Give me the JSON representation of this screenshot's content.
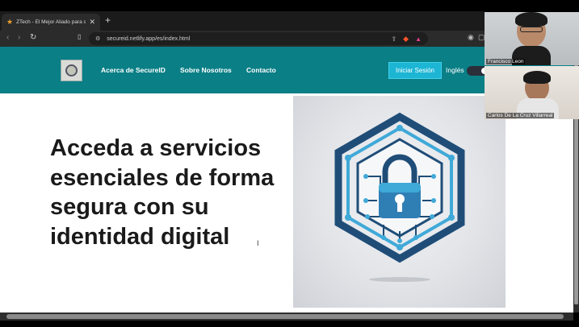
{
  "browser": {
    "tab_title": "ZTech - El Mejor Aliado para su",
    "tab_close": "✕",
    "new_tab": "+",
    "url": "secureid.netlify.app/es/index.html"
  },
  "site": {
    "nav": {
      "links": [
        "Acerca de SecureID",
        "Sobre Nosotros",
        "Contacto"
      ],
      "login_label": "Iniciar Sesión",
      "language_label": "Inglés"
    },
    "hero": {
      "title": "Acceda a servicios esenciales de forma segura con su identidad digital"
    }
  },
  "call": {
    "participants": [
      {
        "name": "Francisco Leon"
      },
      {
        "name": "Carlos De La Cruz Villarreal"
      }
    ]
  },
  "colors": {
    "nav_bg": "#0a7f86",
    "button_bg": "#1cb5d4"
  }
}
